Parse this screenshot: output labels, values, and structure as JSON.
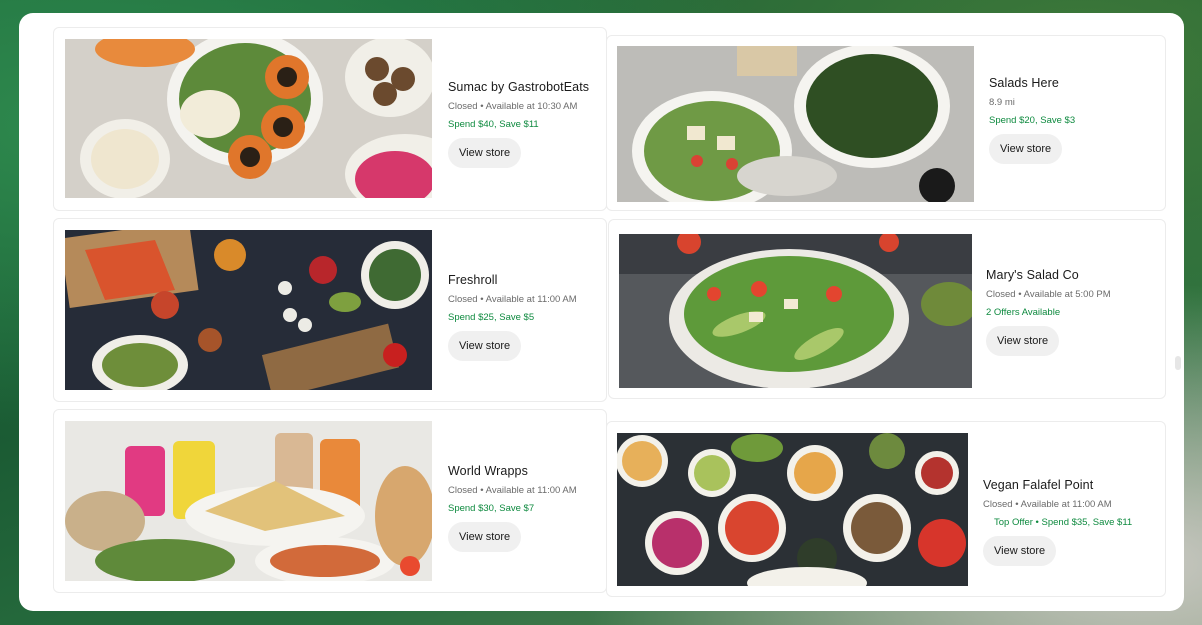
{
  "stores": [
    {
      "name": "Sumac by GastrobotEats",
      "status": "Closed • Available at 10:30 AM",
      "offer": "Spend $40, Save $11",
      "cta": "View store"
    },
    {
      "name": "Salads Here",
      "status": "8.9 mi",
      "offer": "Spend $20, Save $3",
      "cta": "View store"
    },
    {
      "name": "Freshroll",
      "status": "Closed • Available at 11:00 AM",
      "offer": "Spend $25, Save $5",
      "cta": "View store"
    },
    {
      "name": "Mary's Salad Co",
      "status": "Closed • Available at 5:00 PM",
      "offer": "2 Offers Available",
      "cta": "View store"
    },
    {
      "name": "World Wrapps",
      "status": "Closed • Available at 11:00 AM",
      "offer": "Spend $30, Save $7",
      "cta": "View store"
    },
    {
      "name": "Vegan Falafel Point",
      "status": "Closed • Available at 11:00 AM",
      "offer": "Top Offer • Spend $35, Save $11",
      "cta": "View store"
    }
  ],
  "colors": {
    "offer_green": "#0e8a3f",
    "button_bg": "#f0f0f0",
    "background_green": "#1f6b3c"
  }
}
